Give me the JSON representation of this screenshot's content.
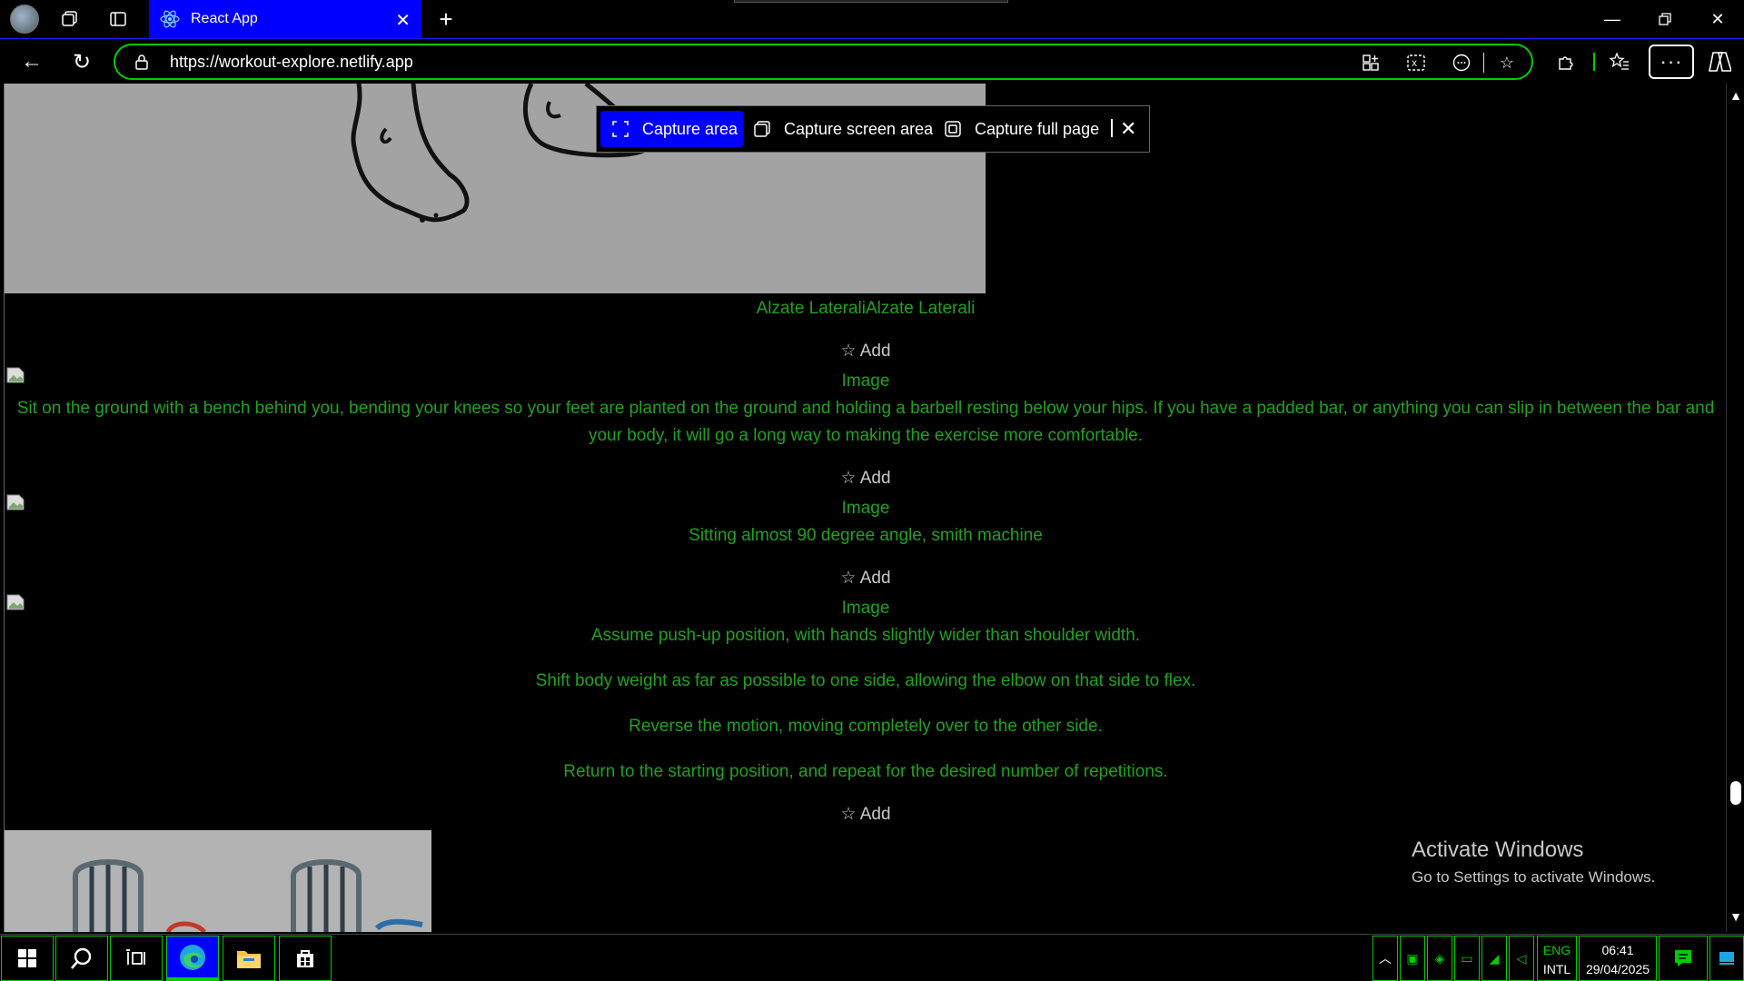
{
  "browser": {
    "tab_title": "React App",
    "url": "https://workout-explore.netlify.app"
  },
  "capture_toolbar": {
    "capture_area": "Capture area",
    "capture_screen_area": "Capture screen area",
    "capture_full_page": "Capture full page"
  },
  "content": {
    "exercise_title": "Alzate LateraliAlzate Laterali",
    "add_label": "☆ Add",
    "image_alt": "Image",
    "description_1": "Sit on the ground with a bench behind you, bending your knees so your feet are planted on the ground and holding a barbell resting below your hips. If you have a padded bar, or anything you can slip in between the bar and your body, it will go a long way to making the exercise more comfortable.",
    "description_2": "Sitting almost 90 degree angle, smith machine",
    "steps": [
      "Assume push-up position, with hands slightly wider than shoulder width.",
      "Shift body weight as far as possible to one side, allowing the elbow on that side to flex.",
      "Reverse the motion, moving completely over to the other side.",
      "Return to the starting position, and repeat for the desired number of repetitions."
    ]
  },
  "watermark": {
    "title": "Activate Windows",
    "subtitle": "Go to Settings to activate Windows."
  },
  "taskbar": {
    "lang_top": "ENG",
    "lang_bottom": "INTL",
    "time": "06:41",
    "date": "29/04/2025"
  },
  "colors": {
    "accent_blue": "#0000ff",
    "highlight_green": "#00cc00",
    "text_green": "#1ea31e"
  },
  "icons": [
    "profile-avatar",
    "workspaces-icon",
    "tab-actions-icon",
    "react-icon",
    "close-icon",
    "plus-icon",
    "back-icon",
    "refresh-icon",
    "lock-icon",
    "app-available-icon",
    "immersive-reader-icon",
    "emoji-icon",
    "favorite-star-icon",
    "extensions-icon",
    "favorites-icon",
    "more-icon",
    "copilot-icon",
    "windows-icon",
    "search-icon",
    "task-view-icon",
    "edge-icon",
    "file-explorer-icon",
    "store-icon",
    "chevron-up-icon",
    "notification-icon"
  ]
}
